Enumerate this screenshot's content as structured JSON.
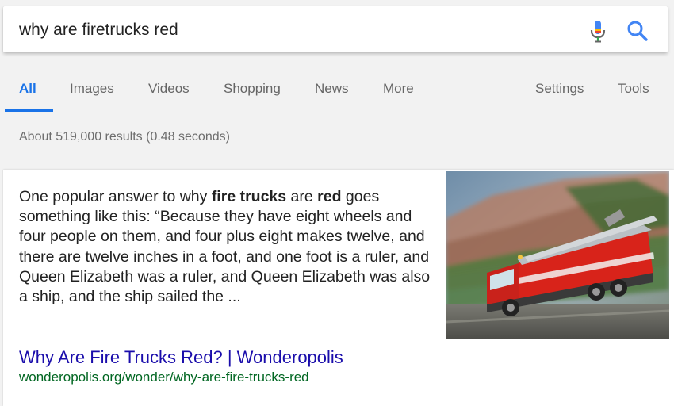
{
  "search": {
    "query": "why are firetrucks red"
  },
  "tabs": {
    "all": "All",
    "images": "Images",
    "videos": "Videos",
    "shopping": "Shopping",
    "news": "News",
    "more": "More",
    "settings": "Settings",
    "tools": "Tools"
  },
  "stats": "About 519,000 results (0.48 seconds)",
  "snippet": {
    "text_1": "One popular answer to why ",
    "bold_1": "fire trucks",
    "text_2": " are ",
    "bold_2": "red",
    "text_3": " goes something like this: “Because they have eight wheels and four people on them, and four plus eight makes twelve, and there are twelve inches in a foot, and one foot is a ruler, and Queen Elizabeth was a ruler, and Queen Elizabeth was also a ship, and the ship sailed the ...",
    "title": "Why Are Fire Trucks Red? | Wonderopolis",
    "url": "wonderopolis.org/wonder/why-are-fire-trucks-red"
  },
  "icons": {
    "mic": "microphone-icon",
    "search": "search-icon"
  },
  "colors": {
    "accent": "#1a73e8",
    "link": "#1a0dab",
    "url": "#006621",
    "truck": "#d8231a"
  }
}
